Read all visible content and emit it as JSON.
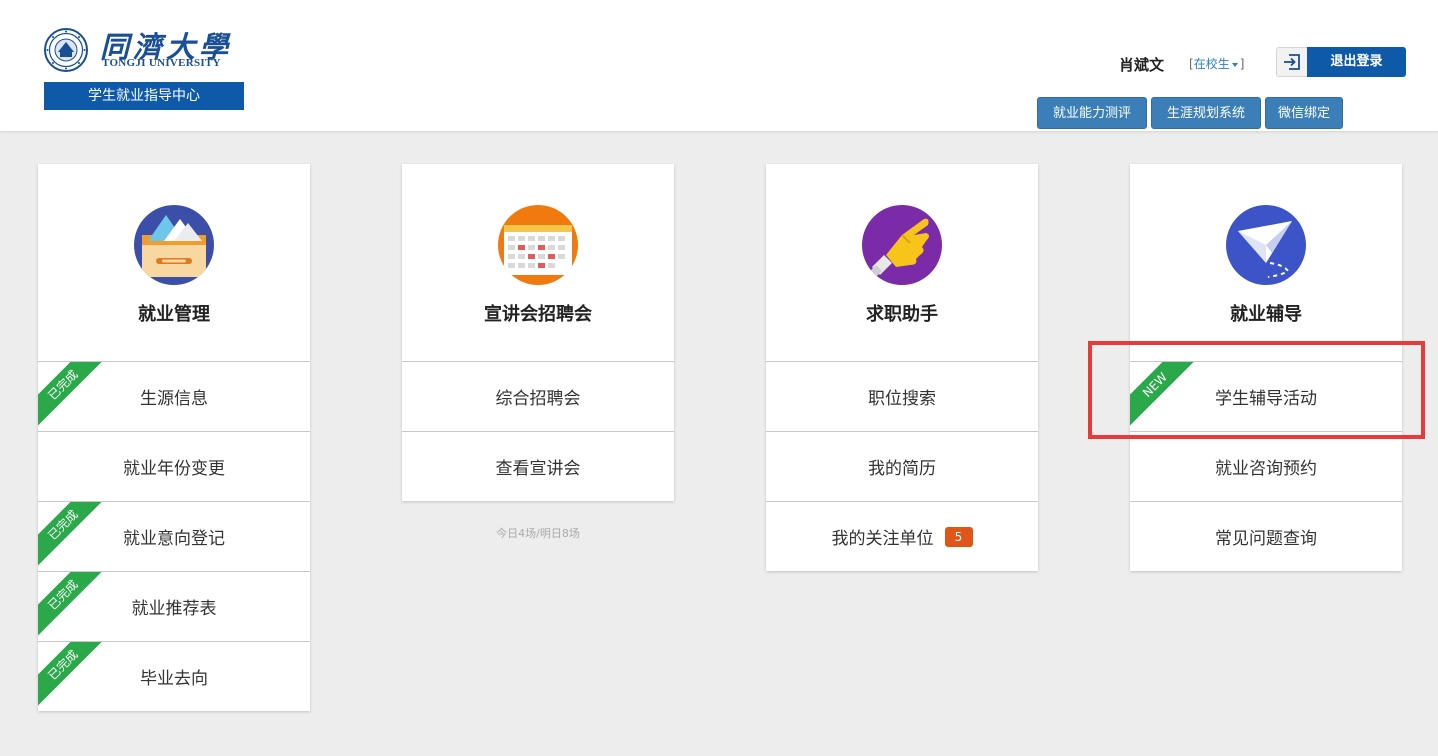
{
  "header": {
    "logo_cn": "同濟大學",
    "logo_en": "TONGJI UNIVERSITY",
    "center_name": "学生就业指导中心",
    "user_name": "肖斌文",
    "status_open": "[",
    "status": "在校生",
    "status_close": "]",
    "logout_label": "退出登录",
    "buttons": [
      {
        "label": "就业能力测评"
      },
      {
        "label": "生涯规划系统"
      },
      {
        "label": "微信绑定"
      }
    ]
  },
  "cards": [
    {
      "title": "就业管理",
      "icon": "drawer-icon",
      "rows": [
        {
          "label": "生源信息",
          "ribbon": "已完成"
        },
        {
          "label": "就业年份变更"
        },
        {
          "label": "就业意向登记",
          "ribbon": "已完成"
        },
        {
          "label": "就业推荐表",
          "ribbon": "已完成"
        },
        {
          "label": "毕业去向",
          "ribbon": "已完成"
        }
      ]
    },
    {
      "title": "宣讲会招聘会",
      "icon": "calendar-icon",
      "rows": [
        {
          "label": "综合招聘会"
        },
        {
          "label": "查看宣讲会"
        }
      ],
      "note": "今日4场/明日8场"
    },
    {
      "title": "求职助手",
      "icon": "pointing-hand-icon",
      "rows": [
        {
          "label": "职位搜索"
        },
        {
          "label": "我的简历"
        },
        {
          "label": "我的关注单位",
          "badge": "5"
        }
      ]
    },
    {
      "title": "就业辅导",
      "icon": "paper-plane-icon",
      "rows": [
        {
          "label": "学生辅导活动",
          "ribbon": "NEW"
        },
        {
          "label": "就业咨询预约"
        },
        {
          "label": "常见问题查询"
        }
      ]
    }
  ],
  "colors": {
    "brand": "#0f5aa8",
    "ribbon": "#2aa84a",
    "badge": "#e0561a",
    "highlight": "#e83a3a"
  }
}
